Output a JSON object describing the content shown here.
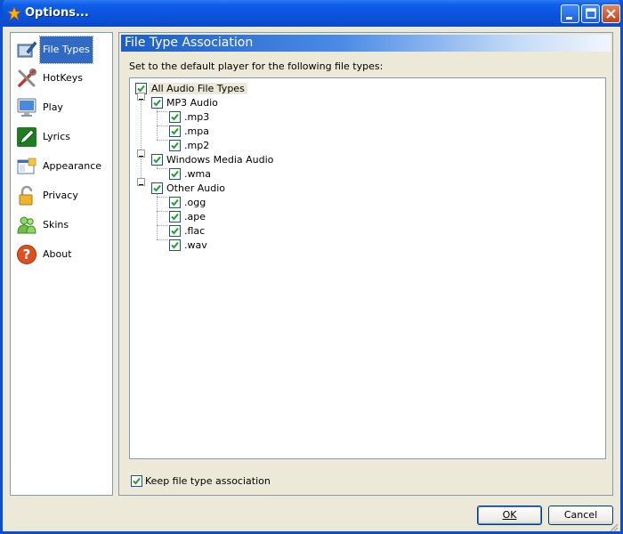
{
  "window": {
    "title": "Options..."
  },
  "sidebar": {
    "items": [
      {
        "label": "File Types",
        "icon": "file-types-icon",
        "active": true
      },
      {
        "label": "HotKeys",
        "icon": "tools-icon"
      },
      {
        "label": "Play",
        "icon": "monitor-icon"
      },
      {
        "label": "Lyrics",
        "icon": "pen-icon"
      },
      {
        "label": "Appearance",
        "icon": "window-icon"
      },
      {
        "label": "Privacy",
        "icon": "lock-icon"
      },
      {
        "label": "Skins",
        "icon": "users-icon"
      },
      {
        "label": "About",
        "icon": "help-icon"
      }
    ]
  },
  "panel": {
    "title": "File Type Association",
    "description": "Set to the default player for the following file types:",
    "tree": {
      "root": "All Audio File Types",
      "groups": [
        {
          "label": "MP3 Audio",
          "children": [
            ".mp3",
            ".mpa",
            ".mp2"
          ]
        },
        {
          "label": "Windows Media Audio",
          "children": [
            ".wma"
          ]
        },
        {
          "label": "Other Audio",
          "children": [
            ".ogg",
            ".ape",
            ".flac",
            ".wav"
          ]
        }
      ]
    },
    "keep_association": {
      "label": "Keep file type association",
      "checked": true
    }
  },
  "buttons": {
    "ok": "OK",
    "cancel": "Cancel"
  }
}
